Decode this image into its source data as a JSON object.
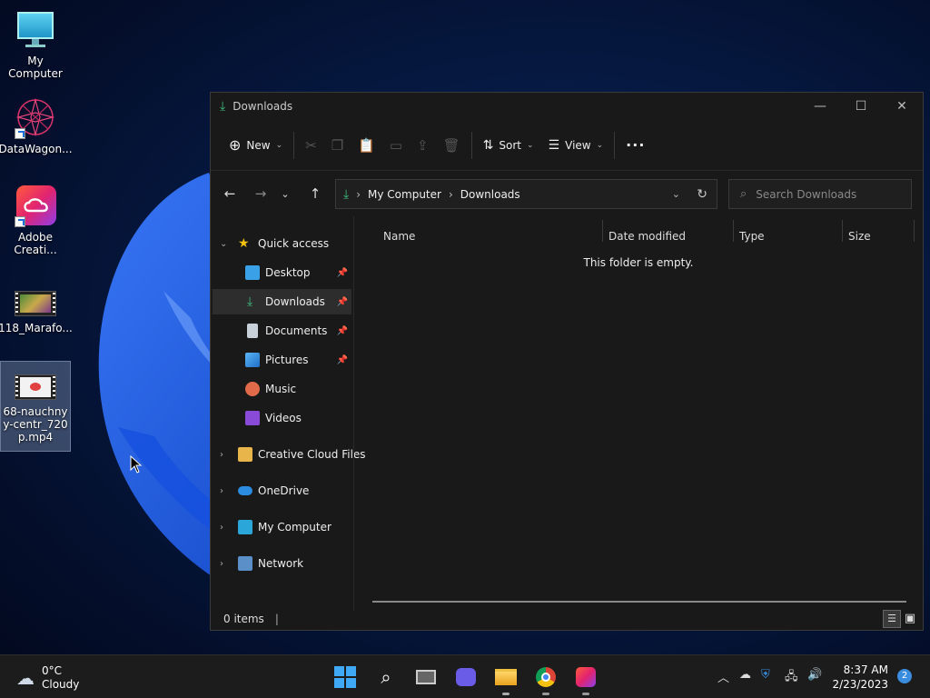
{
  "desktop": {
    "icons": [
      {
        "label": "My Computer",
        "icon": "monitor-icon"
      },
      {
        "label": "DataWagon...",
        "icon": "datawagon-icon"
      },
      {
        "label": "Adobe Creati...",
        "icon": "adobe-cc-icon"
      },
      {
        "label": "118_Marafo...",
        "icon": "video-file-icon"
      },
      {
        "label": "68-nauchnyy-centr_720p.mp4",
        "icon": "video-file-icon"
      }
    ]
  },
  "window": {
    "title": "Downloads",
    "toolbar": {
      "new_label": "New",
      "sort_label": "Sort",
      "view_label": "View",
      "more_label": "···"
    },
    "address": {
      "segments": [
        "My Computer",
        "Downloads"
      ]
    },
    "search": {
      "placeholder": "Search Downloads"
    },
    "sidebar": {
      "quick_access": "Quick access",
      "items": [
        {
          "label": "Desktop",
          "pinned": true
        },
        {
          "label": "Downloads",
          "pinned": true
        },
        {
          "label": "Documents",
          "pinned": true
        },
        {
          "label": "Pictures",
          "pinned": true
        },
        {
          "label": "Music",
          "pinned": false
        },
        {
          "label": "Videos",
          "pinned": false
        }
      ],
      "roots": [
        {
          "label": "Creative Cloud Files"
        },
        {
          "label": "OneDrive"
        },
        {
          "label": "My Computer"
        },
        {
          "label": "Network"
        }
      ]
    },
    "columns": [
      "Name",
      "Date modified",
      "Type",
      "Size"
    ],
    "empty_message": "This folder is empty.",
    "status": {
      "items_count": "0 items"
    }
  },
  "taskbar": {
    "weather": {
      "temp": "0°C",
      "condition": "Cloudy"
    },
    "clock": {
      "time": "8:37 AM",
      "date": "2/23/2023"
    },
    "notification_count": "2"
  },
  "colors": {
    "accent": "#3a8dde",
    "window_bg": "#191919",
    "download_green": "#3dbd7d"
  }
}
